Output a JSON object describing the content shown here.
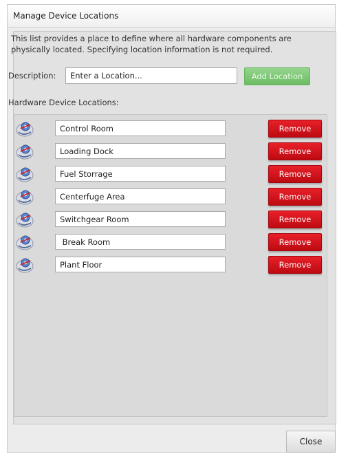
{
  "dialog": {
    "title": "Manage Device Locations",
    "intro_text": "This list provides a place to define where all hardware components are physically located. Specifying location information is not required.",
    "description_label": "Description:",
    "description_placeholder": "Enter a Location...",
    "add_button_label": "Add Location",
    "list_label": "Hardware Device Locations:",
    "close_button_label": "Close"
  },
  "locations": [
    {
      "name": "Control Room",
      "remove_label": "Remove"
    },
    {
      "name": "Loading Dock",
      "remove_label": "Remove"
    },
    {
      "name": "Fuel Storrage",
      "remove_label": "Remove"
    },
    {
      "name": "Centerfuge Area",
      "remove_label": "Remove"
    },
    {
      "name": "Switchgear Room",
      "remove_label": "Remove"
    },
    {
      "name": " Break Room",
      "remove_label": "Remove"
    },
    {
      "name": "Plant Floor",
      "remove_label": "Remove"
    }
  ],
  "icons": {
    "location_row_icon": "compass-location-icon"
  },
  "colors": {
    "add_button": "#7cc574",
    "remove_button": "#d0121b",
    "panel_background": "#e2e2e2"
  }
}
